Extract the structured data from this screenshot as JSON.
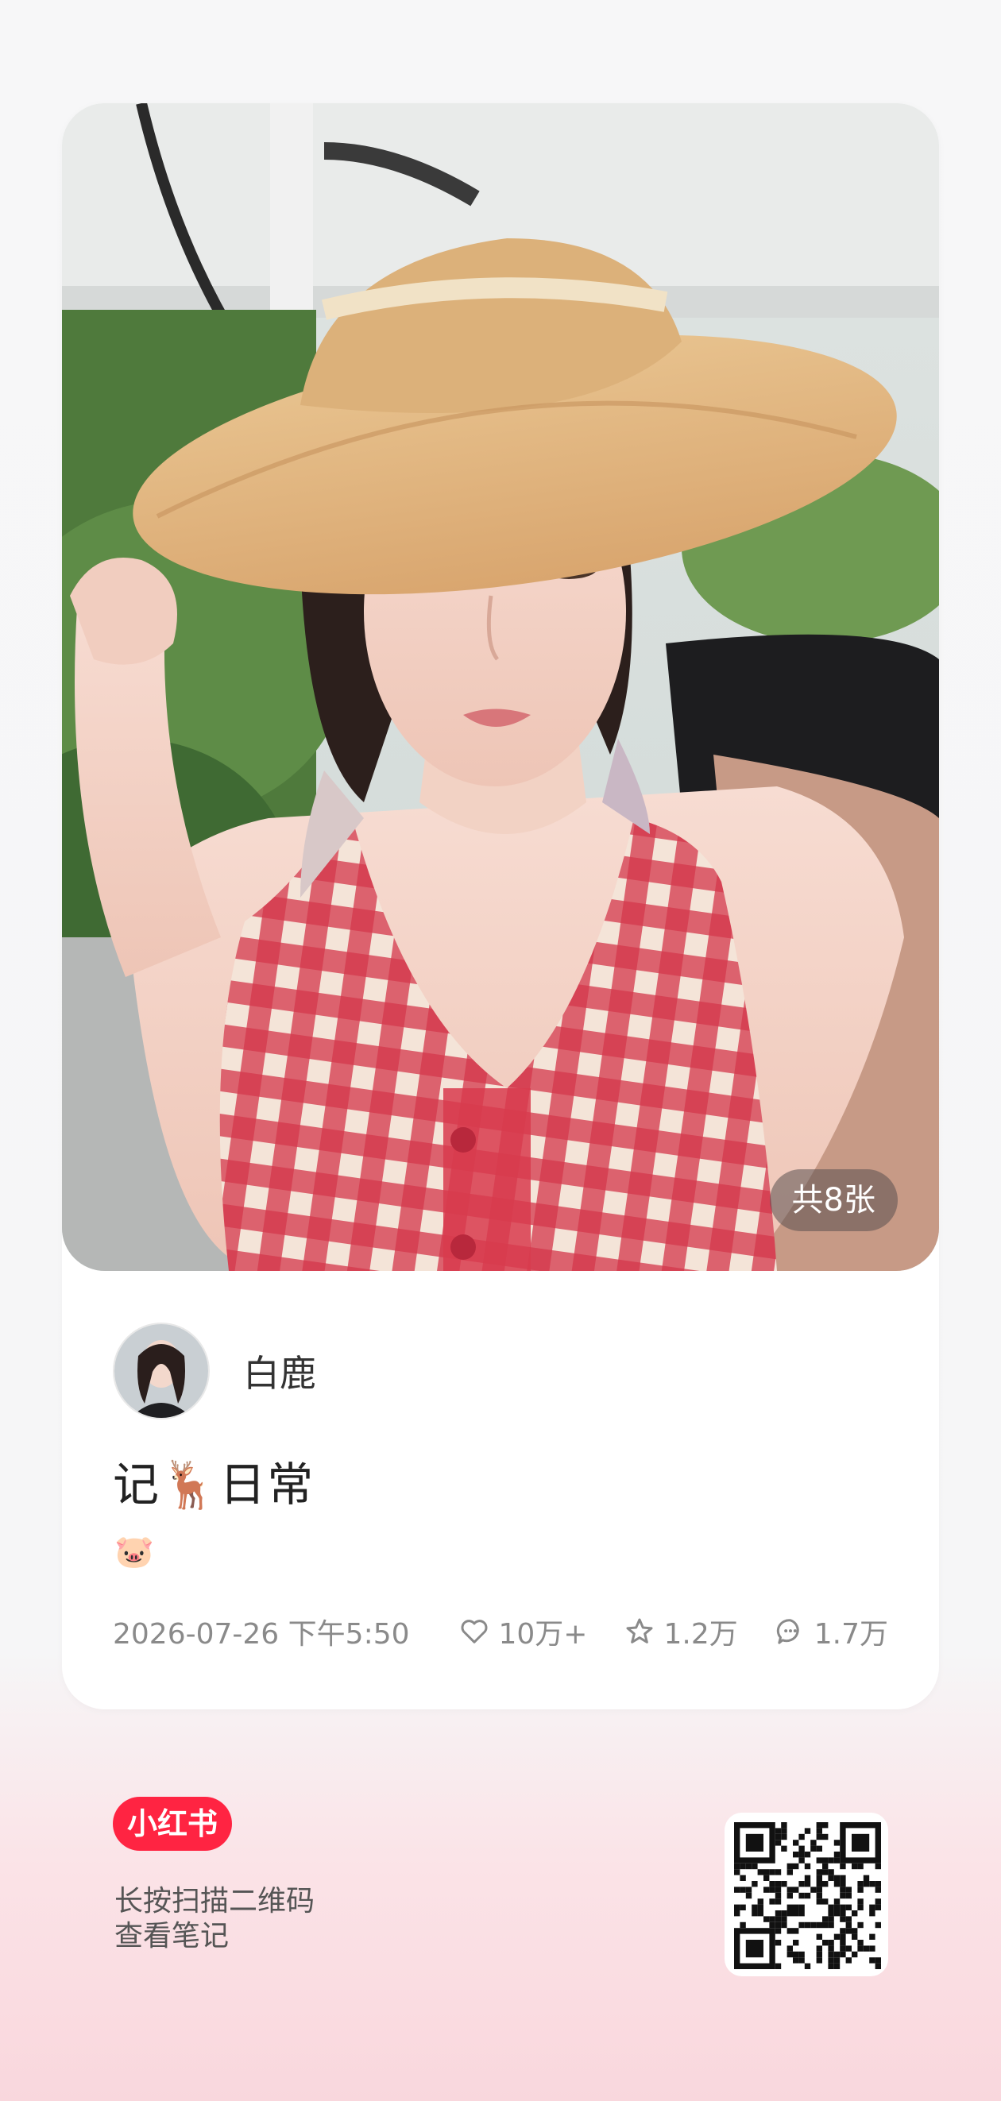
{
  "post": {
    "image_count_label": "共8张",
    "author_name": "白鹿",
    "title": "记🦌日常",
    "body_emoji": "🐷",
    "date": "2026-07-26 下午5:50",
    "likes": "10万+",
    "collects": "1.2万",
    "comments": "1.7万"
  },
  "footer": {
    "brand": "小红书",
    "scan_line1": "长按扫描二维码",
    "scan_line2": "查看笔记"
  },
  "icons": {
    "like": "heart-icon",
    "collect": "star-icon",
    "comment": "chat-bubble-icon"
  },
  "colors": {
    "brand_red": "#ff2442",
    "meta_gray": "#8a8a8a"
  }
}
